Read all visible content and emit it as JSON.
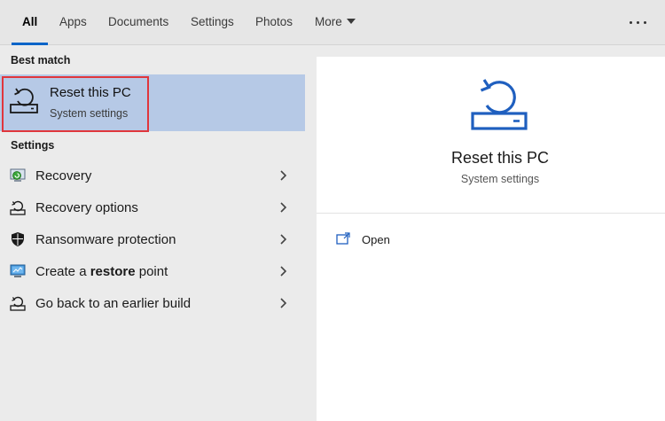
{
  "tabs": [
    {
      "label": "All",
      "active": true
    },
    {
      "label": "Apps"
    },
    {
      "label": "Documents"
    },
    {
      "label": "Settings"
    },
    {
      "label": "Photos"
    },
    {
      "label": "More"
    }
  ],
  "more_icon": "more-options-icon",
  "best_match": {
    "heading": "Best match",
    "title": "Reset this PC",
    "subtitle": "System settings",
    "icon": "reset-pc-icon"
  },
  "settings": {
    "heading": "Settings",
    "items": [
      {
        "label": "Recovery",
        "icon": "recovery-icon"
      },
      {
        "label": "Recovery options",
        "icon": "recovery-options-icon"
      },
      {
        "label": "Ransomware protection",
        "icon": "shield-icon"
      },
      {
        "label_pre": "Create a ",
        "label_bold": "restore",
        "label_post": " point",
        "icon": "restore-point-icon"
      },
      {
        "label": "Go back to an earlier build",
        "icon": "earlier-build-icon"
      }
    ]
  },
  "preview": {
    "title": "Reset this PC",
    "subtitle": "System settings",
    "actions": [
      {
        "label": "Open",
        "icon": "open-icon"
      }
    ]
  },
  "colors": {
    "accent": "#0a64c8",
    "selection": "#b6c9e6",
    "highlight_border": "#e0363c",
    "icon_blue": "#1f5fbf"
  }
}
